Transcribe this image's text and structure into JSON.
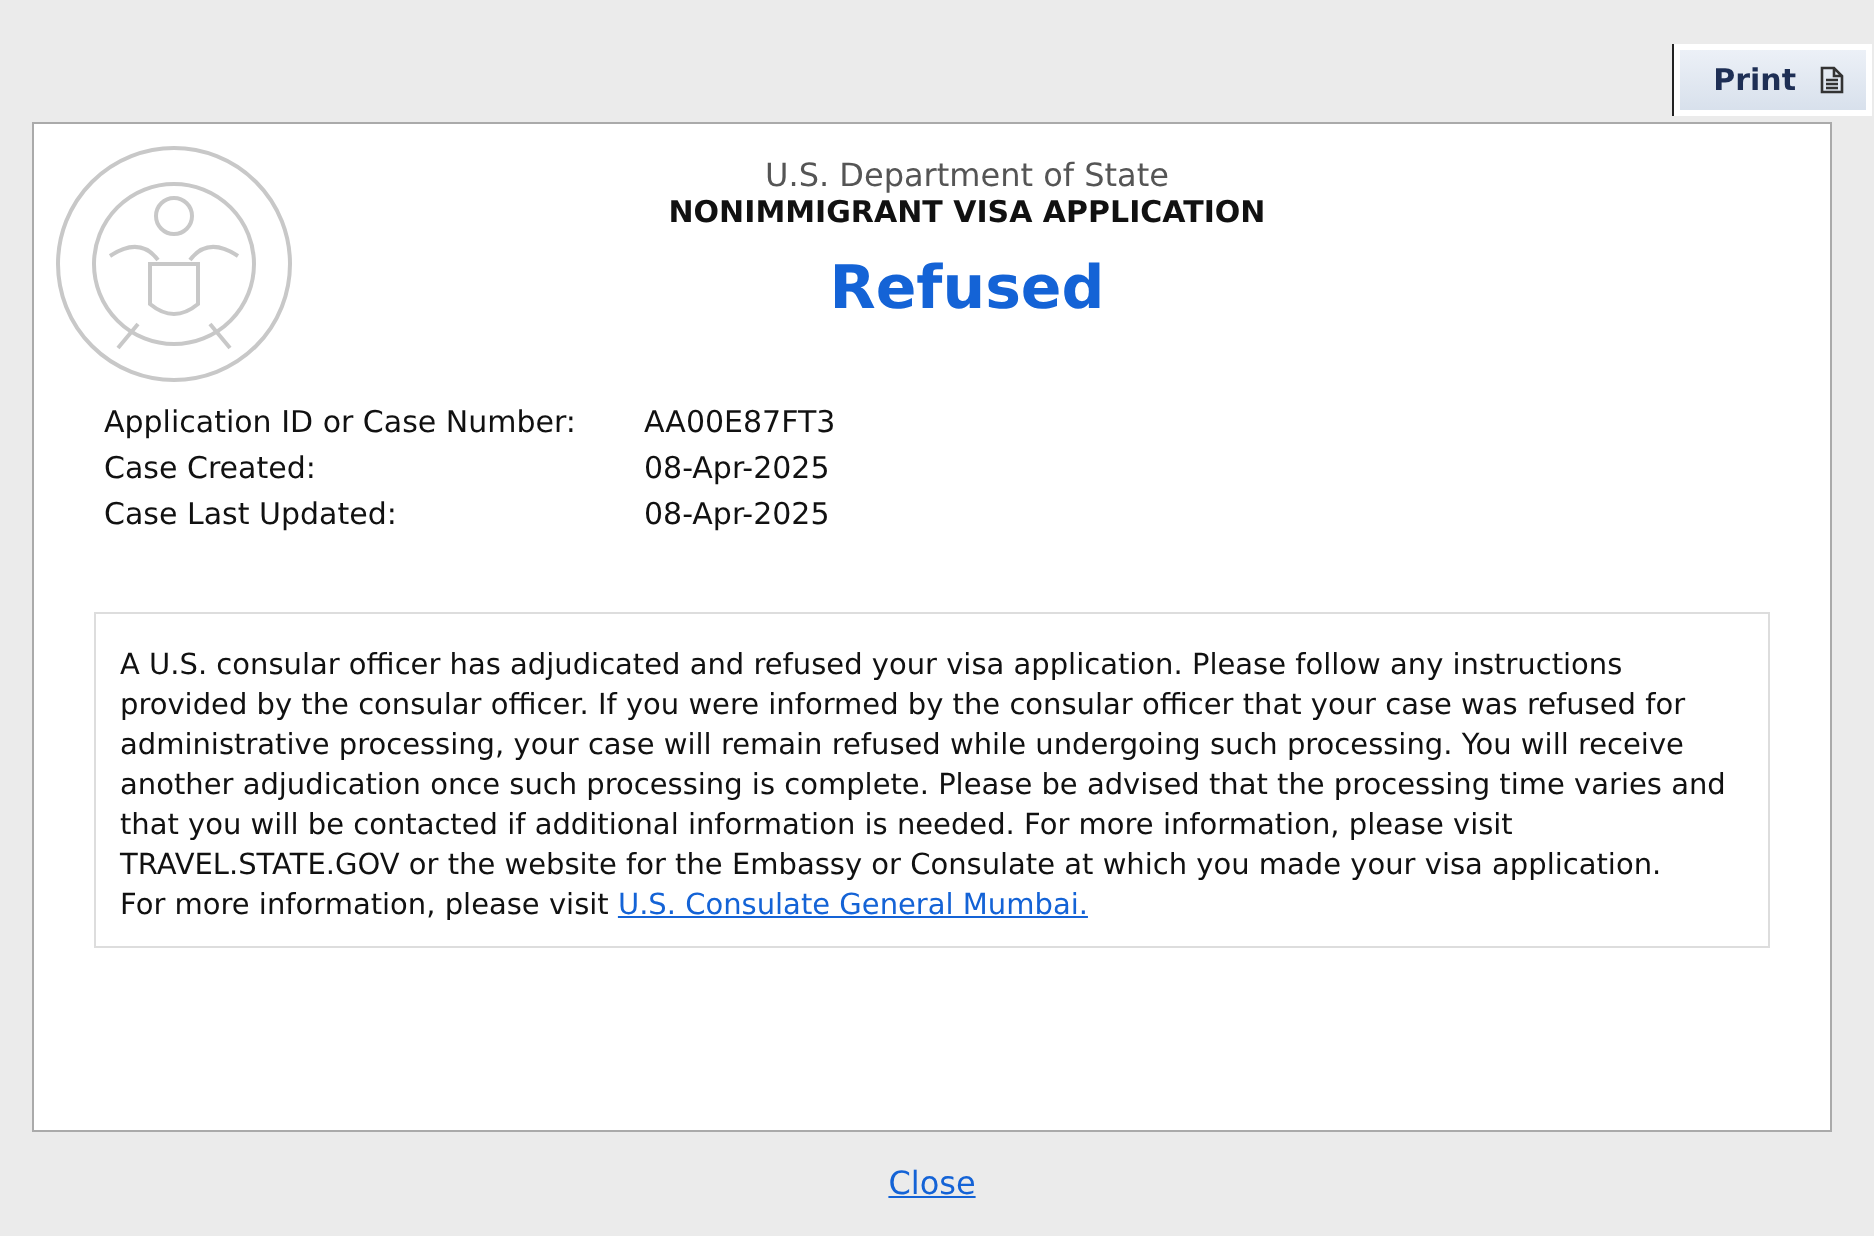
{
  "print_button": {
    "label": "Print"
  },
  "header": {
    "department": "U.S. Department of State",
    "form_title": "NONIMMIGRANT VISA APPLICATION",
    "status": "Refused"
  },
  "case_details": [
    {
      "label": "Application ID or Case Number:",
      "value": "AA00E87FT3"
    },
    {
      "label": "Case Created:",
      "value": "08-Apr-2025"
    },
    {
      "label": "Case Last Updated:",
      "value": "08-Apr-2025"
    }
  ],
  "message": {
    "text": "A U.S. consular officer has adjudicated and refused your visa application. Please follow any instructions provided by the consular officer. If you were informed by the consular officer that your case was refused for administrative processing, your case will remain refused while undergoing such processing. You will receive another adjudication once such processing is complete. Please be advised that the processing time varies and that you will be contacted if additional information is needed. For more information, please visit TRAVEL.STATE.GOV or the website for the Embassy or Consulate at which you made your visa application.",
    "more_prefix": "For more information, please visit",
    "more_link": "U.S. Consulate General Mumbai."
  },
  "close_link": "Close"
}
